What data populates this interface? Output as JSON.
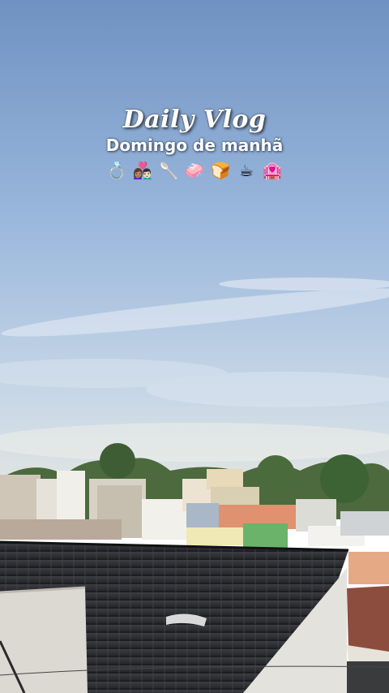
{
  "overlay": {
    "title": "Daily Vlog",
    "subtitle": "Domingo de manhã",
    "emojis": [
      "💍",
      "👩🏽‍❤️‍👨🏻",
      "🥄",
      "🧼",
      "🍞",
      "☕",
      "🏩"
    ]
  },
  "colors": {
    "sky_top": "#7a9bc6",
    "sky_mid": "#a9c3e0",
    "sky_horizon": "#dbe3e7",
    "roof": "#2f3033",
    "wall": "#e9e6e1"
  }
}
